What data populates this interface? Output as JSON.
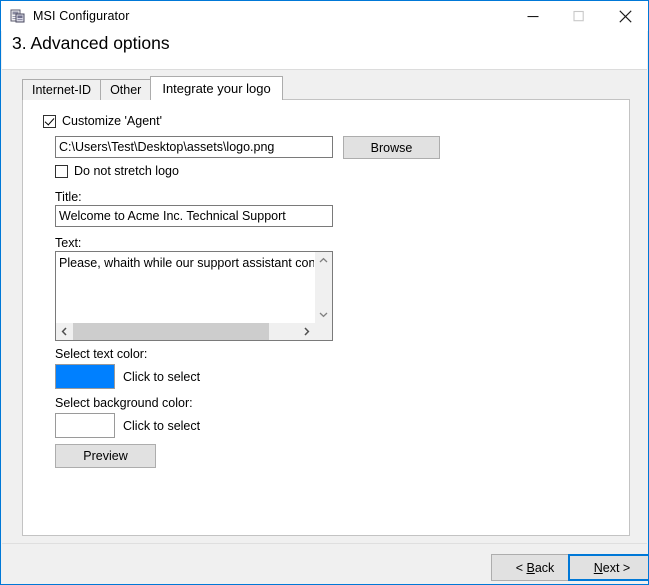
{
  "window": {
    "title": "MSI Configurator",
    "icon": "msi-installer-icon",
    "controls": {
      "minimize": "minimize-icon",
      "maximize": "maximize-icon",
      "close": "close-icon"
    }
  },
  "header": {
    "title": "3. Advanced options"
  },
  "tabs": [
    {
      "label": "Internet-ID",
      "selected": false
    },
    {
      "label": "Other",
      "selected": false
    },
    {
      "label": "Integrate your logo",
      "selected": true
    }
  ],
  "form": {
    "customize_agent": {
      "label": "Customize 'Agent'",
      "checked": true
    },
    "logo_path": {
      "value": "C:\\Users\\Test\\Desktop\\assets\\logo.png",
      "placeholder": ""
    },
    "browse_button": "Browse",
    "do_not_stretch": {
      "label": "Do not stretch logo",
      "checked": false
    },
    "title_label": "Title:",
    "title_value": "Welcome to Acme Inc. Technical Support",
    "text_label": "Text:",
    "text_value": "Please, whaith while our support assistant connects t",
    "text_color_label": "Select text color:",
    "text_color_hint": "Click to select",
    "text_color_value": "#0080ff",
    "background_color_label": "Select background color:",
    "background_color_hint": "Click to select",
    "background_color_value": "#ffffff",
    "preview_button": "Preview"
  },
  "footer": {
    "back_button": "< Back",
    "back_accel": "B",
    "next_button": "Next >",
    "next_accel": "N"
  },
  "colors": {
    "accent": "#0078d7",
    "window_bg": "#f0f0f0",
    "panel_bg": "#ffffff",
    "button_face": "#e1e1e1",
    "scroll_thumb": "#cdcdcd"
  }
}
